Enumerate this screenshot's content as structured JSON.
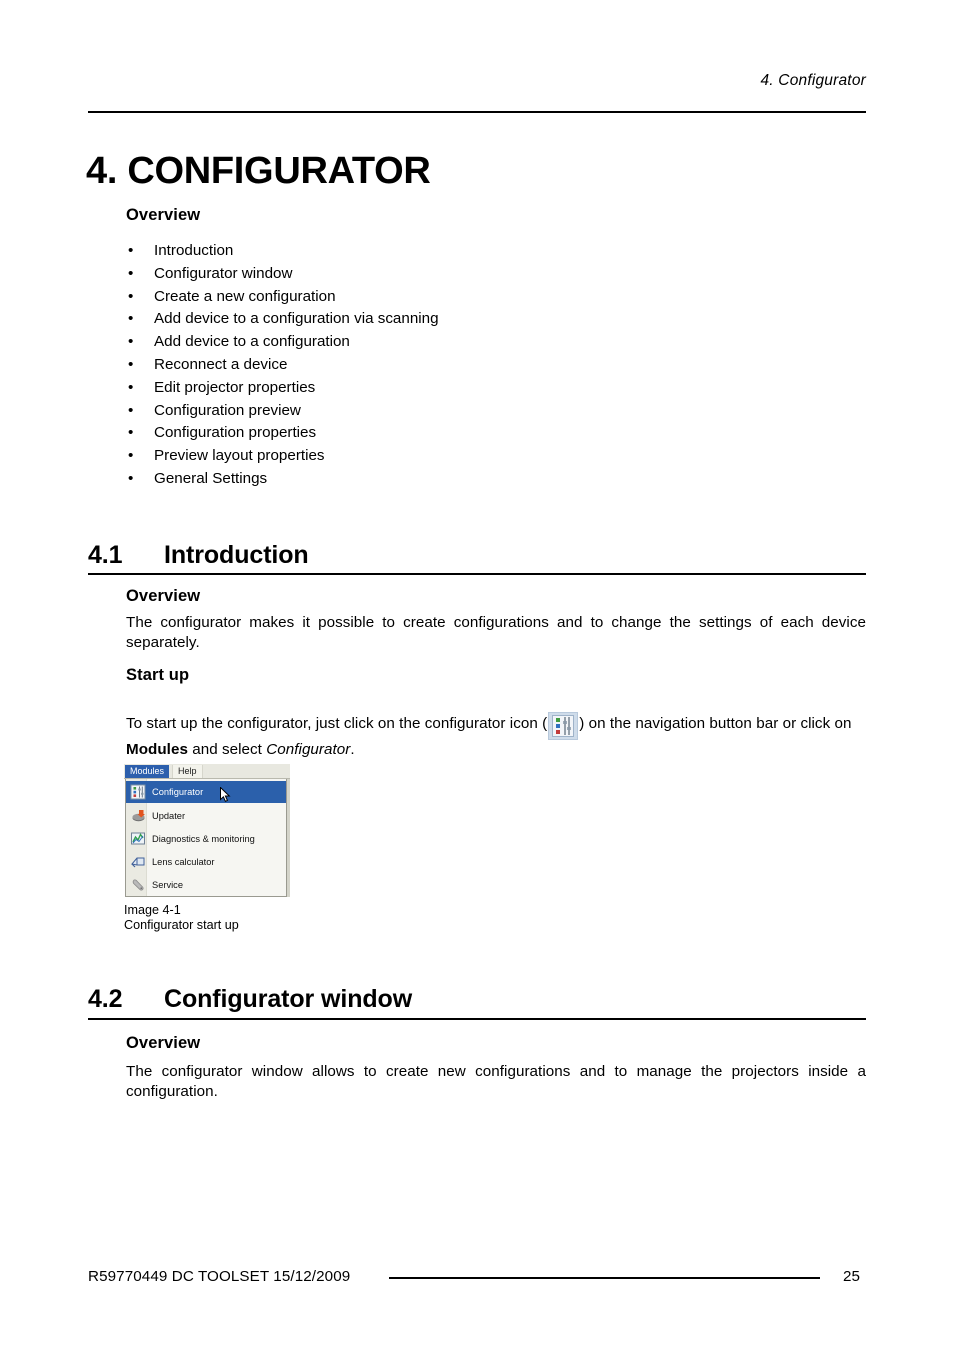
{
  "header": {
    "running_head": "4.  Configurator"
  },
  "chapter": {
    "title": "4. CONFIGURATOR",
    "overview_heading": "Overview",
    "overview_items": [
      "Introduction",
      "Configurator window",
      "Create a new configuration",
      "Add device to a configuration via scanning",
      "Add device to a configuration",
      "Reconnect a device",
      "Edit projector properties",
      "Configuration preview",
      "Configuration properties",
      "Preview layout properties",
      "General Settings"
    ],
    "bullet_glyph": "•"
  },
  "section_41": {
    "number": "4.1",
    "title": "Introduction",
    "overview_heading": "Overview",
    "overview_body": "The configurator makes it possible to create configurations and to change the settings of each device separately.",
    "startup_heading": "Start up",
    "startup_body_part1": "To start up the configurator, just click on the configurator icon (",
    "startup_body_part2": ") on the navigation button bar or click on ",
    "startup_body_bold": "Modules",
    "startup_body_part3": " and select ",
    "startup_body_italic": "Configurator",
    "startup_body_part4": "."
  },
  "figure": {
    "icon_name": "configurator-icon",
    "caption_line1": "Image 4-1",
    "caption_line2": "Configurator start up",
    "screenshot": {
      "menubar": [
        {
          "label": "Modules",
          "active": true
        },
        {
          "label": "Help",
          "active": false
        }
      ],
      "menu_items": [
        {
          "label": "Configurator",
          "icon": "configurator-icon",
          "selected": true
        },
        {
          "label": "Updater",
          "icon": "updater-icon",
          "selected": false
        },
        {
          "label": "Diagnostics & monitoring",
          "icon": "diagnostics-icon",
          "selected": false
        },
        {
          "label": "Lens calculator",
          "icon": "lens-calculator-icon",
          "selected": false
        },
        {
          "label": "Service",
          "icon": "service-wrench-icon",
          "selected": false
        }
      ],
      "highlight_color": "#2b60ab",
      "menubar_color": "#e8e8e0"
    }
  },
  "section_42": {
    "number": "4.2",
    "title": "Configurator window",
    "overview_heading": "Overview",
    "overview_body": "The configurator window allows to create new configurations and to manage the projectors inside a configuration."
  },
  "footer": {
    "left": "R59770449  DC TOOLSET  15/12/2009",
    "page_number": "25"
  }
}
